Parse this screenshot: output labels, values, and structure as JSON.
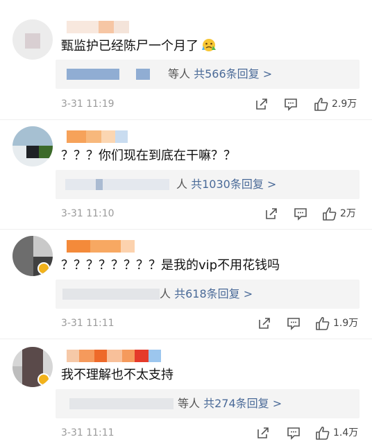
{
  "comments": [
    {
      "text": "甄监护已经陈尸一个月了",
      "emoji_icon": "crying-face-emoji",
      "reply_prefix": "等人",
      "reply_count": "共566条回复 >",
      "time": "3-31 11:19",
      "likes": "2.9万"
    },
    {
      "text": "？？？你们现在到底在干嘛？？",
      "reply_prefix": "人",
      "reply_count": "共1030条回复 >",
      "time": "3-31 11:10",
      "likes": "2万"
    },
    {
      "text": "？？？？？？？？是我的vip不用花钱吗",
      "reply_prefix": "人",
      "reply_count": "共618条回复 >",
      "time": "3-31 11:11",
      "likes": "1.9万"
    },
    {
      "text": "我不理解也不太支持",
      "reply_prefix": "等人",
      "reply_count": "共274条回复 >",
      "time": "3-31 11:11",
      "likes": "1.4万"
    }
  ],
  "icons": {
    "share": "share-icon",
    "comment": "comment-icon",
    "like": "thumbs-up-icon"
  },
  "colors": {
    "link": "#4a6a98",
    "meta": "#9a9a9a",
    "reply_bg": "#f4f4f4"
  }
}
